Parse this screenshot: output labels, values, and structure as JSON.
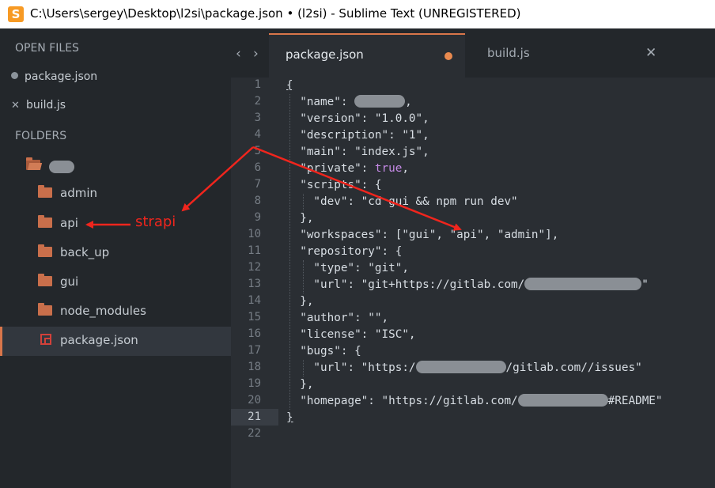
{
  "window": {
    "title": "C:\\Users\\sergey\\Desktop\\l2si\\package.json • (l2si) - Sublime Text (UNREGISTERED)",
    "app_icon_glyph": "S"
  },
  "sidebar": {
    "open_files_heading": "OPEN FILES",
    "open_files": [
      {
        "name": "package.json",
        "state": "modified"
      },
      {
        "name": "build.js",
        "state": "close"
      }
    ],
    "folders_heading": "FOLDERS",
    "tree": [
      {
        "label": "admin"
      },
      {
        "label": "api"
      },
      {
        "label": "back_up"
      },
      {
        "label": "gui"
      },
      {
        "label": "node_modules"
      },
      {
        "label": "package.json",
        "selected": true
      }
    ]
  },
  "tabs": [
    {
      "label": "package.json",
      "active": true,
      "dirty": true
    },
    {
      "label": "build.js",
      "active": false,
      "close_glyph": "✕"
    }
  ],
  "nav": {
    "back_glyph": "‹",
    "forward_glyph": "›"
  },
  "editor": {
    "current_line": 21,
    "line_numbers": [
      "1",
      "2",
      "3",
      "4",
      "5",
      "6",
      "7",
      "8",
      "9",
      "10",
      "11",
      "12",
      "13",
      "14",
      "15",
      "16",
      "17",
      "18",
      "19",
      "20",
      "21",
      "22"
    ],
    "lines": [
      "{",
      "  \"name\": ,",
      "  \"version\": \"1.0.0\",",
      "  \"description\": \"1\",",
      "  \"main\": \"index.js\",",
      "  \"private\": true,",
      "  \"scripts\": {",
      "    \"dev\": \"cd gui && npm run dev\"",
      "  },",
      "  \"workspaces\": [\"gui\", \"api\", \"admin\"],",
      "  \"repository\": {",
      "    \"type\": \"git\",",
      "    \"url\": \"git+https://gitlab.com/\"",
      "  },",
      "  \"author\": \"\",",
      "  \"license\": \"ISC\",",
      "  \"bugs\": {",
      "    \"url\": \"https://gitlab.com//issues\"",
      "  },",
      "  \"homepage\": \"https://gitlab.com/#README\"",
      "}",
      ""
    ]
  },
  "annotation": {
    "label": "strapi",
    "color": "#f0251d"
  },
  "colors": {
    "accent": "#d9764a",
    "folder": "#c96f4b",
    "json_icon": "#d2413a",
    "keyword": "#c58ae6"
  }
}
